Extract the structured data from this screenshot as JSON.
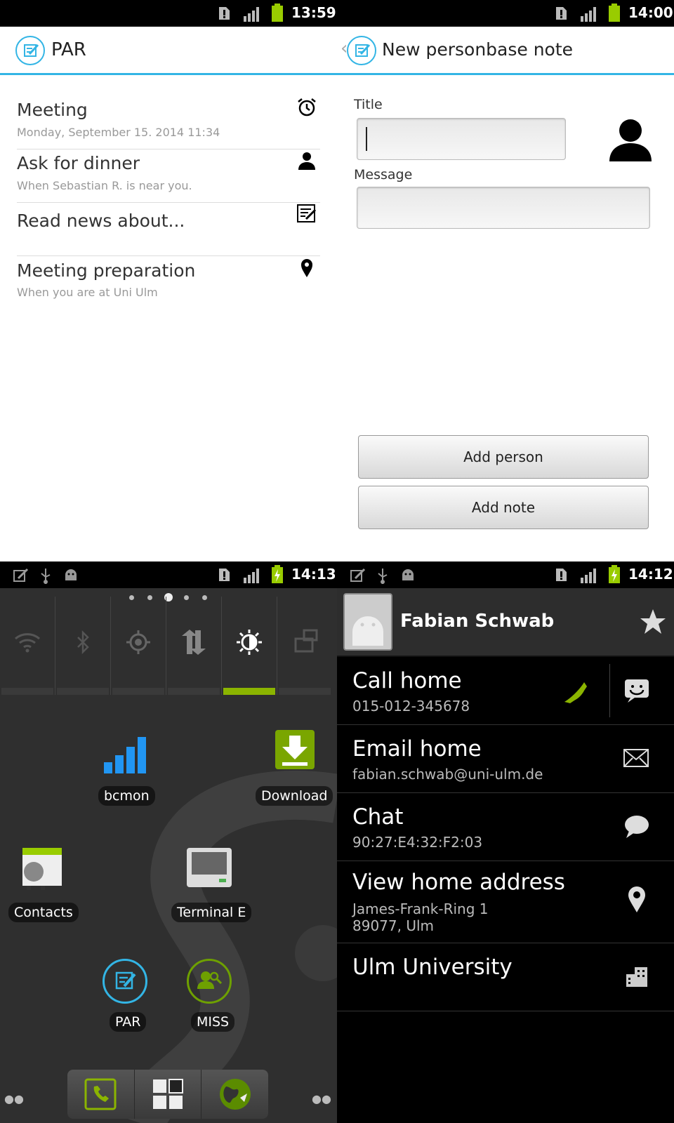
{
  "colors": {
    "accent": "#33b5e5",
    "battery": "#99cc00",
    "dock_green": "#8bb400"
  },
  "status": {
    "q1_time": "13:59",
    "q2_time": "14:00",
    "q3_time": "14:13",
    "q4_time": "14:12"
  },
  "par_list": {
    "app_title": "PAR",
    "items": [
      {
        "title": "Meeting",
        "subtitle": "Monday, September 15. 2014 11:34",
        "icon": "alarm-clock-icon"
      },
      {
        "title": "Ask for dinner",
        "subtitle": "When Sebastian R. is near you.",
        "icon": "person-icon"
      },
      {
        "title": "Read news about...",
        "subtitle": "",
        "icon": "note-edit-icon"
      },
      {
        "title": "Meeting preparation",
        "subtitle": "When you are at Uni Ulm",
        "icon": "map-pin-icon"
      }
    ]
  },
  "new_note": {
    "title": "New personbase note",
    "title_label": "Title",
    "title_value": "",
    "message_label": "Message",
    "message_value": "",
    "add_person": "Add person",
    "add_note": "Add note"
  },
  "home": {
    "apps": [
      {
        "label": "bcmon",
        "icon": "signal-bars-icon"
      },
      {
        "label": "Download",
        "icon": "download-icon"
      },
      {
        "label": "Contacts",
        "icon": "contacts-book-icon"
      },
      {
        "label": "Terminal E",
        "icon": "terminal-icon"
      },
      {
        "label": "PAR",
        "icon": "par-note-icon"
      },
      {
        "label": "MISS",
        "icon": "miss-people-icon"
      }
    ],
    "quick_settings": [
      "wifi-icon",
      "bluetooth-icon",
      "gps-icon",
      "data-sync-icon",
      "brightness-icon",
      "rotation-icon"
    ],
    "dock": [
      "phone-icon",
      "app-drawer-icon",
      "browser-globe-icon"
    ]
  },
  "contact": {
    "name": "Fabian Schwab",
    "rows": [
      {
        "title": "Call home",
        "sub": "015-012-345678"
      },
      {
        "title": "Email home",
        "sub": "fabian.schwab@uni-ulm.de"
      },
      {
        "title": "Chat",
        "sub": "90:27:E4:32:F2:03"
      },
      {
        "title": "View home address",
        "sub1": "James-Frank-Ring 1",
        "sub2": "89077, Ulm"
      },
      {
        "title": "Ulm University",
        "sub": ""
      }
    ]
  }
}
